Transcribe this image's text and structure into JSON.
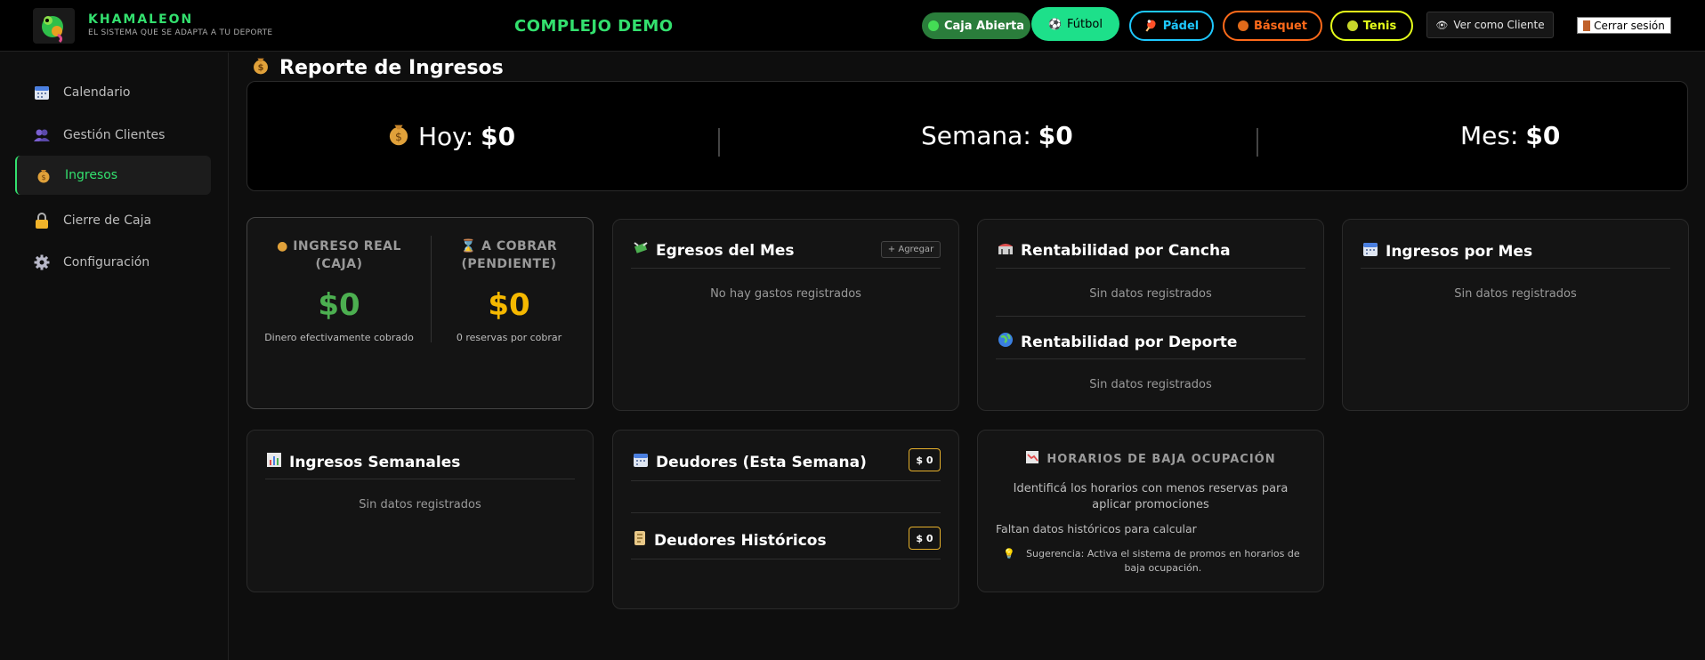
{
  "header": {
    "brand_name": "KHAMALEON",
    "brand_tagline": "EL SISTEMA QUE SE ADAPTA A TU DEPORTE",
    "complex_name": "COMPLEJO DEMO",
    "caja_label": "Caja Abierta",
    "sports": [
      {
        "label": "Fútbol",
        "color": "#1de08a"
      },
      {
        "label": "Pádel",
        "color": "#1ec8ff"
      },
      {
        "label": "Básquet",
        "color": "#ff6a1a"
      },
      {
        "label": "Tenis",
        "color": "#e5ff1a"
      }
    ],
    "ver_cliente_label": "Ver como Cliente",
    "cerrar_sesion_label": "Cerrar sesión"
  },
  "sidebar": {
    "items": [
      {
        "label": "Calendario",
        "icon": "calendar-icon"
      },
      {
        "label": "Gestión Clientes",
        "icon": "users-icon"
      },
      {
        "label": "Ingresos",
        "icon": "money-bag-icon",
        "active": true
      },
      {
        "label": "Cierre de Caja",
        "icon": "lock-icon"
      },
      {
        "label": "Configuración",
        "icon": "gear-icon"
      }
    ]
  },
  "report": {
    "title": "Reporte de Ingresos",
    "hoy_label": "Hoy:",
    "hoy_value": "$0",
    "semana_label": "Semana:",
    "semana_value": "$0",
    "mes_label": "Mes:",
    "mes_value": "$0"
  },
  "caja_card": {
    "real_label_1": "INGRESO REAL",
    "real_label_2": "(CAJA)",
    "real_value": "$0",
    "real_note": "Dinero efectivamente cobrado",
    "cobrar_label_1": "A COBRAR",
    "cobrar_label_2": "(PENDIENTE)",
    "cobrar_value": "$0",
    "cobrar_note": "0 reservas por cobrar"
  },
  "egresos": {
    "title": "Egresos del Mes",
    "add_label": "+ Agregar",
    "empty": "No hay gastos registrados"
  },
  "rentabilidad": {
    "cancha_title": "Rentabilidad por Cancha",
    "cancha_empty": "Sin datos registrados",
    "deporte_title": "Rentabilidad por Deporte",
    "deporte_empty": "Sin datos registrados"
  },
  "ingresos_mes": {
    "title": "Ingresos por Mes",
    "empty": "Sin datos registrados"
  },
  "ingresos_semanales": {
    "title": "Ingresos Semanales",
    "empty": "Sin datos registrados"
  },
  "deudores": {
    "semana_title": "Deudores (Esta Semana)",
    "semana_badge": "$ 0",
    "historicos_title": "Deudores Históricos",
    "historicos_badge": "$ 0"
  },
  "baja_ocupacion": {
    "title": "HORARIOS DE BAJA OCUPACIÓN",
    "description": "Identificá los horarios con menos reservas para aplicar promociones",
    "missing": "Faltan datos históricos para calcular",
    "suggestion": "Sugerencia: Activa el sistema de promos en horarios de baja ocupación."
  },
  "colors": {
    "accent": "#33e06e",
    "real": "#4caf50",
    "pending": "#f5b800",
    "badge_border": "#e5b02c"
  }
}
